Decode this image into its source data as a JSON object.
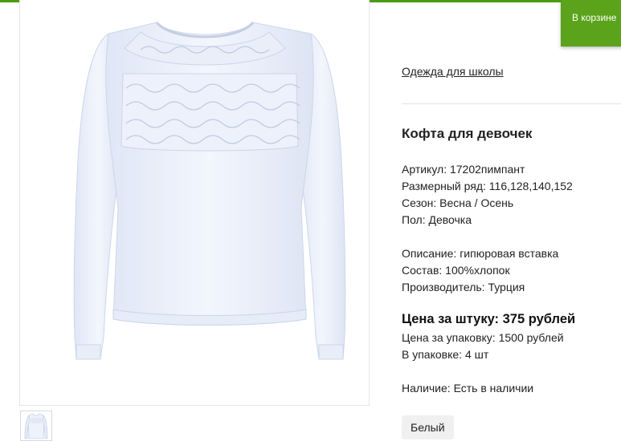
{
  "theme": {
    "accent_color": "#5aa31b",
    "top_strip_color": "#4c9a1a"
  },
  "header": {
    "cart_label": "В корзине"
  },
  "gallery": {
    "main_image": "white-long-sleeve-girls-top-with-lace-insert",
    "thumbnail": "white-long-sleeve-girls-top-thumbnail"
  },
  "breadcrumb": {
    "category": "Одежда для школы"
  },
  "product": {
    "title": "Кофта для девочек",
    "article": "Артикул: 17202пимпант",
    "sizes": "Размерный ряд: 116,128,140,152",
    "season": "Сезон: Весна / Осень",
    "gender": "Пол: Девочка",
    "description": "Описание: гипюровая вставка",
    "composition": "Состав: 100%хлопок",
    "manufacturer": "Производитель: Турция",
    "price_unit": "Цена за штуку: 375 рублей",
    "price_pack": "Цена за упаковку: 1500 рублей",
    "pack_qty": "В упаковке: 4 шт",
    "availability": "Наличие: Есть в наличии",
    "color_option": "Белый"
  }
}
